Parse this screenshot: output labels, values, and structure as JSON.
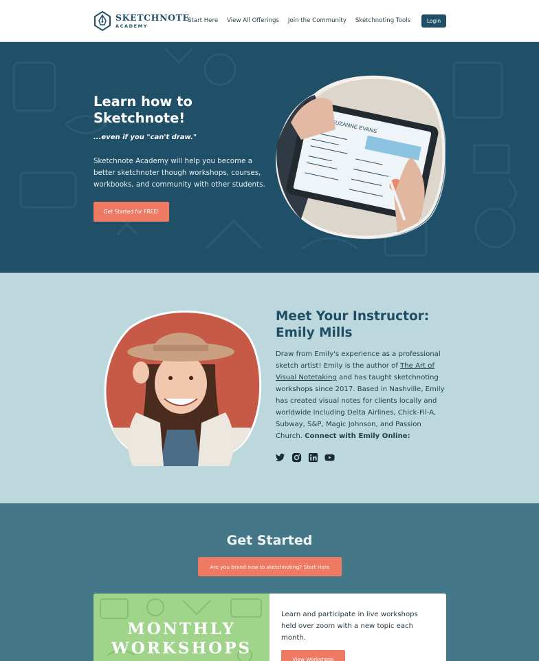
{
  "header": {
    "logo_line1": "SKETCHNOTE",
    "logo_line2": "ACADEMY",
    "nav": [
      "Start Here",
      "View All Offerings",
      "Join the Community",
      "Sketchnoting Tools"
    ],
    "login": "Login"
  },
  "hero": {
    "title": "Learn how to Sketchnote!",
    "subtitle": "...even if you \"can't draw.\"",
    "description": "Sketchnote Academy will help you become a better sketchnoter though workshops, courses, workbooks, and community with other students.",
    "cta": "Get Started for FREE!",
    "tablet_name": "SUZANNE EVANS"
  },
  "instructor": {
    "title": "Meet Your Instructor: Emily Mills",
    "bio_part1": "Draw from Emily's experience as a professional sketch artist! Emily is the author of ",
    "book_link": "The Art of Visual Notetaking",
    "bio_part2": " and has taught sketchnoting workshops since 2017. Based in Nashville, Emily has created visual notes for clients locally and worldwide including Delta Airlines, Chick-Fil-A, Subway, S&P, Magic Johnson, and Passion Church. ",
    "connect": "Connect with Emily Online:",
    "social": [
      "twitter-icon",
      "instagram-icon",
      "linkedin-icon",
      "youtube-icon"
    ]
  },
  "get_started": {
    "title": "Get Started",
    "cta": "Are you brand new to sketchnoting? Start Here",
    "card": {
      "image_title_line1": "MONTHLY",
      "image_title_line2": "WORKSHOPS",
      "text": "Learn and participate in live workshops held over zoom with a new topic each month.",
      "button": "View Workshops"
    }
  },
  "colors": {
    "brand_dark": "#1f5068",
    "accent": "#ee7a63",
    "light_teal": "#bcd8dc",
    "mid_teal": "#447787",
    "workshop_green": "#9fd48a"
  }
}
